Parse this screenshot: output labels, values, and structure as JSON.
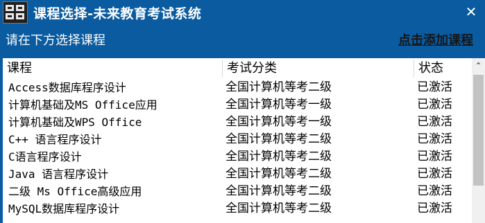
{
  "window": {
    "title": "课程选择-未来教育考试系统",
    "close_symbol": "✕",
    "logo_icon": "app-logo-icon"
  },
  "toolbar": {
    "instruction": "请在下方选择课程",
    "add_link": "点击添加课程"
  },
  "table": {
    "headers": [
      "课程",
      "考试分类",
      "状态"
    ],
    "rows": [
      [
        "Access数据库程序设计",
        "全国计算机等考二级",
        "已激活"
      ],
      [
        "计算机基础及MS Office应用",
        "全国计算机等考一级",
        "已激活"
      ],
      [
        "计算机基础及WPS Office",
        "全国计算机等考一级",
        "已激活"
      ],
      [
        "C++ 语言程序设计",
        "全国计算机等考二级",
        "已激活"
      ],
      [
        "C语言程序设计",
        "全国计算机等考二级",
        "已激活"
      ],
      [
        "Java 语言程序设计",
        "全国计算机等考二级",
        "已激活"
      ],
      [
        "二级 Ms Office高级应用",
        "全国计算机等考二级",
        "已激活"
      ],
      [
        "MySQL数据库程序设计",
        "全国计算机等考二级",
        "已激活"
      ]
    ]
  },
  "scrollbar": {
    "up_symbol": "⌃"
  },
  "colors": {
    "titlebar": "#0a5ba0",
    "link": "#161616",
    "list_bg": "#ffffff"
  }
}
